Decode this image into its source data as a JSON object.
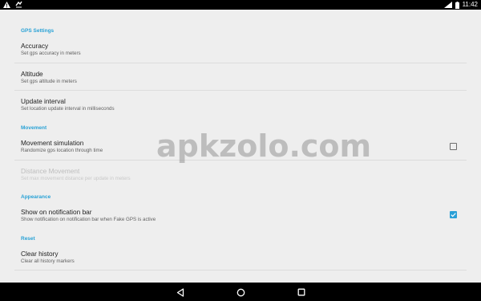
{
  "status_bar": {
    "time": "11:42",
    "left_icons": [
      "warning-icon",
      "fake-gps-app-icon"
    ],
    "right_icons": [
      "wifi-icon",
      "battery-icon"
    ]
  },
  "watermark": "apkzolo.com",
  "sections": {
    "gps_settings": {
      "header": "GPS Settings",
      "accuracy": {
        "title": "Accuracy",
        "summary": "Set gps accuracy in meters"
      },
      "altitude": {
        "title": "Altitude",
        "summary": "Set gps altitude in meters"
      },
      "update_interval": {
        "title": "Update interval",
        "summary": "Set location update interval in milliseconds"
      }
    },
    "movement": {
      "header": "Movement",
      "movement_simulation": {
        "title": "Movement simulation",
        "summary": "Randomize gps location through time",
        "checked": false
      },
      "distance_movement": {
        "title": "Distance Movement",
        "summary": "Set max movement distance per update in meters",
        "enabled": false
      }
    },
    "appearance": {
      "header": "Appearance",
      "notification_bar": {
        "title": "Show on notification bar",
        "summary": "Show notification on notification bar when Fake GPS is active",
        "checked": true
      }
    },
    "reset": {
      "header": "Reset",
      "clear_history": {
        "title": "Clear history",
        "summary": "Clear all history markers"
      }
    }
  },
  "nav_bar": {
    "buttons": [
      "back-icon",
      "home-icon",
      "recents-icon"
    ]
  },
  "colors": {
    "accent": "#29a2d6",
    "background": "#eeeeee",
    "bars": "#000000"
  }
}
